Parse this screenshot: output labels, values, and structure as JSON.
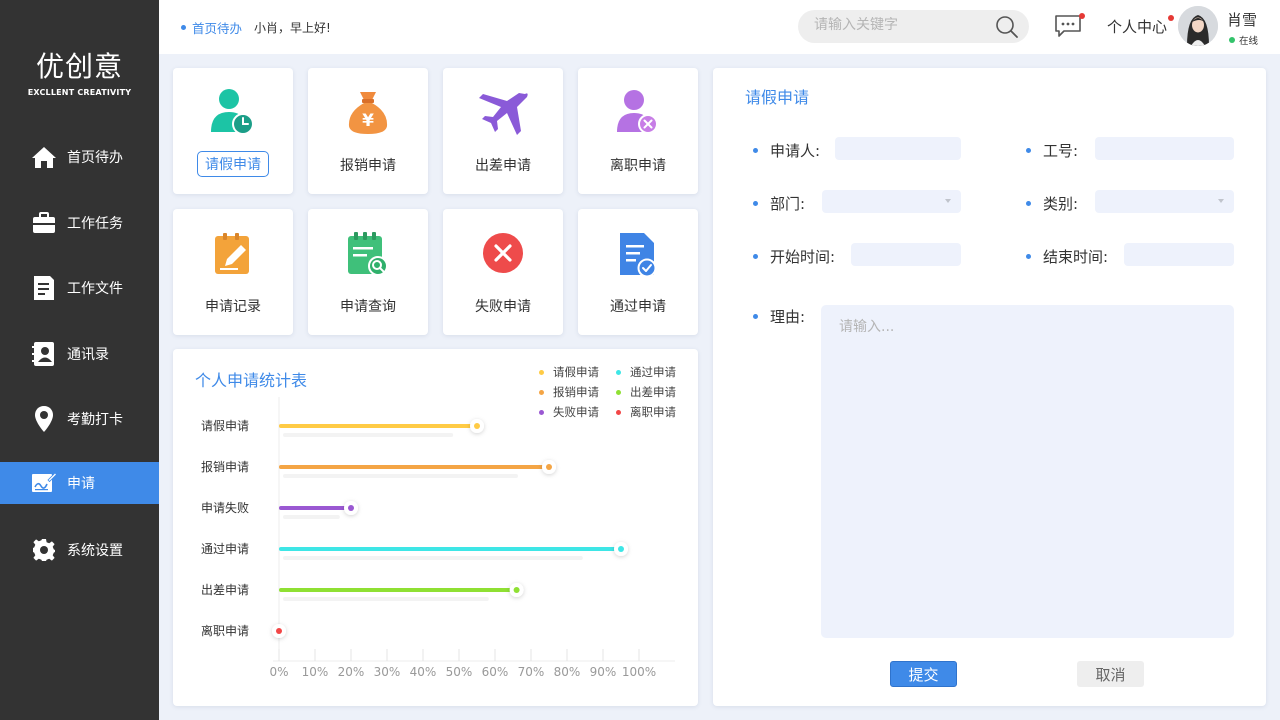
{
  "app": {
    "logo_title": "优创意",
    "logo_subtitle": "EXCLLENT CREATIVITY"
  },
  "sidebar": {
    "items": [
      {
        "label": "首页待办",
        "icon": "home-icon"
      },
      {
        "label": "工作任务",
        "icon": "briefcase-icon"
      },
      {
        "label": "工作文件",
        "icon": "document-icon"
      },
      {
        "label": "通讯录",
        "icon": "contacts-icon"
      },
      {
        "label": "考勤打卡",
        "icon": "location-pin-icon"
      },
      {
        "label": "申请",
        "icon": "sign-form-icon",
        "active": true
      },
      {
        "label": "系统设置",
        "icon": "gear-icon"
      }
    ]
  },
  "header": {
    "breadcrumb": "首页待办",
    "greeting": "小肖，早上好!",
    "search_placeholder": "请输入关键字",
    "user_center": "个人中心",
    "user_name": "肖雪",
    "user_status": "在线"
  },
  "cards": [
    {
      "label": "请假申请",
      "icon": "leave-person-clock-icon",
      "selected": true
    },
    {
      "label": "报销申请",
      "icon": "money-bag-yen-icon"
    },
    {
      "label": "出差申请",
      "icon": "airplane-icon"
    },
    {
      "label": "离职申请",
      "icon": "person-remove-icon"
    },
    {
      "label": "申请记录",
      "icon": "notepad-pencil-icon"
    },
    {
      "label": "申请查询",
      "icon": "calendar-search-icon"
    },
    {
      "label": "失败申请",
      "icon": "close-circle-icon"
    },
    {
      "label": "通过申请",
      "icon": "document-check-icon"
    }
  ],
  "chart_data": {
    "type": "bar",
    "orientation": "horizontal",
    "title": "个人申请统计表",
    "categories": [
      "请假申请",
      "报销申请",
      "申请失败",
      "通过申请",
      "出差申请",
      "离职申请"
    ],
    "values": [
      55,
      75,
      20,
      95,
      66,
      0
    ],
    "colors": [
      "#ffcb45",
      "#f4a545",
      "#9a58d2",
      "#3ee6e6",
      "#8fe033",
      "#f24646"
    ],
    "x_ticks": [
      "0%",
      "10%",
      "20%",
      "30%",
      "40%",
      "50%",
      "60%",
      "70%",
      "80%",
      "90%",
      "100%"
    ],
    "xlim": [
      0,
      100
    ],
    "legend_position": "top-right",
    "legend": [
      {
        "name": "请假申请",
        "color": "#ffcb45"
      },
      {
        "name": "通过申请",
        "color": "#3ee6e6"
      },
      {
        "name": "报销申请",
        "color": "#f4a545"
      },
      {
        "name": "出差申请",
        "color": "#8fe033"
      },
      {
        "name": "失败申请",
        "color": "#9a58d2"
      },
      {
        "name": "离职申请",
        "color": "#f24646"
      }
    ]
  },
  "form": {
    "title": "请假申请",
    "applicant_label": "申请人:",
    "applicant_value": "",
    "employee_id_label": "工号:",
    "employee_id_value": "",
    "department_label": "部门:",
    "department_value": "",
    "category_label": "类别:",
    "category_value": "",
    "start_label": "开始时间:",
    "start_value": "",
    "end_label": "结束时间:",
    "end_value": "",
    "reason_label": "理由:",
    "reason_placeholder": "请输入...",
    "submit_label": "提交",
    "cancel_label": "取消"
  }
}
